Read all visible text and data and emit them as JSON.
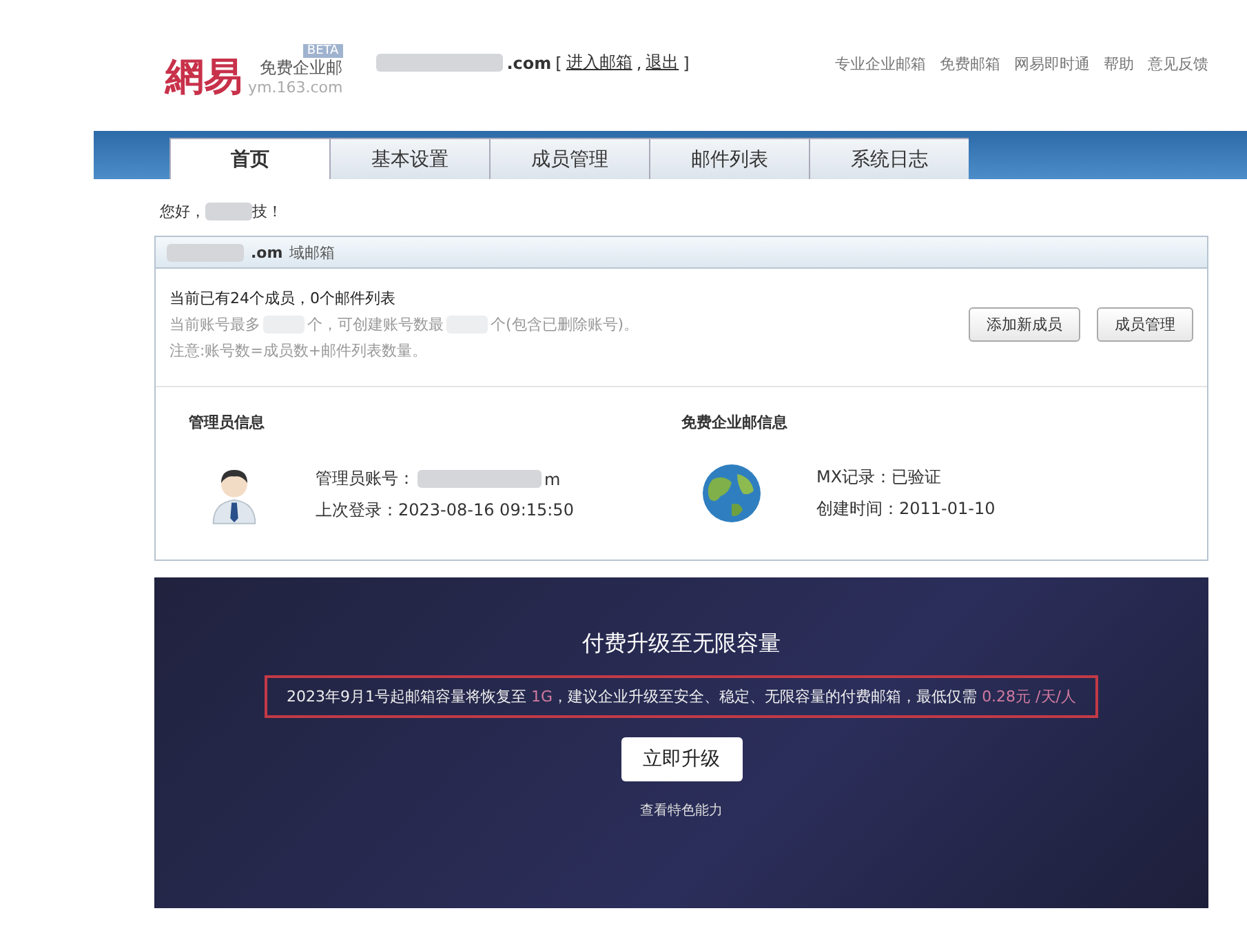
{
  "header": {
    "logo": "網易",
    "product": "免费企业邮",
    "beta": "BETA",
    "site": "ym.163.com",
    "domain_suffix": ".com",
    "links_open": "[",
    "link_enter": "进入邮箱",
    "link_sep": ",",
    "link_logout": "退出",
    "links_close": "]",
    "top_links": [
      "专业企业邮箱",
      "免费邮箱",
      "网易即时通",
      "帮助",
      "意见反馈"
    ]
  },
  "tabs": [
    {
      "label": "首页",
      "selected": true
    },
    {
      "label": "基本设置",
      "selected": false
    },
    {
      "label": "成员管理",
      "selected": false
    },
    {
      "label": "邮件列表",
      "selected": false
    },
    {
      "label": "系统日志",
      "selected": false
    }
  ],
  "greeting": {
    "prefix": "您好，",
    "suffix": "技！"
  },
  "domain_panel": {
    "title_suffix": ".om",
    "title_label": "域邮箱",
    "summary": "当前已有24个成员，0个邮件列表",
    "limit_a": "当前账号最多",
    "limit_b": "个，可创建账号数最",
    "limit_c": "个(包含已删除账号)。",
    "note": "注意:账号数=成员数+邮件列表数量。",
    "buttons": [
      "添加新成员",
      "成员管理"
    ],
    "admin": {
      "heading": "管理员信息",
      "account_label": "管理员账号：",
      "account_tail": "m",
      "last_login": "上次登录：2023-08-16 09:15:50"
    },
    "mail": {
      "heading": "免费企业邮信息",
      "mx": "MX记录：已验证",
      "created": "创建时间：2011-01-10"
    }
  },
  "promo": {
    "title": "付费升级至无限容量",
    "notice": [
      {
        "text": "2023年9月1号起邮箱容量将恢复至 ",
        "highlight": false
      },
      {
        "text": "1G",
        "highlight": true
      },
      {
        "text": "，建议企业升级至安全、稳定、无限容量的付费邮箱，最低仅需 ",
        "highlight": false
      },
      {
        "text": "0.28元 /天/人",
        "highlight": true
      }
    ],
    "button": "立即升级",
    "link": "查看特色能力"
  }
}
